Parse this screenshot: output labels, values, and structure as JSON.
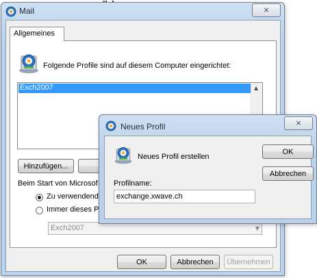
{
  "top_fragment": "„ , “",
  "mail_window": {
    "title": "Mail",
    "close_glyph": "⨯",
    "tab_label": "Allgemeines",
    "profiles_heading": "Folgende Profile sind auf diesem Computer eingerichtet:",
    "profiles": [
      "Exch2007"
    ],
    "add_button": "Hinzufügen...",
    "startup_label": "Beim Start von Microsof",
    "radio_ask": "Zu verwendende",
    "radio_always": "Immer dieses Pr",
    "default_profile": "Exch2007",
    "ok": "OK",
    "cancel": "Abbrechen",
    "apply": "Übernehmen"
  },
  "dialog": {
    "title": "Neues Profil",
    "close_glyph": "⨯",
    "heading": "Neues Profil erstellen",
    "name_label": "Profilname:",
    "name_value": "exchange.xwave.ch",
    "ok": "OK",
    "cancel": "Abbrechen"
  },
  "colors": {
    "selection": "#3399ff",
    "window_frame": "#b9d1ea"
  }
}
